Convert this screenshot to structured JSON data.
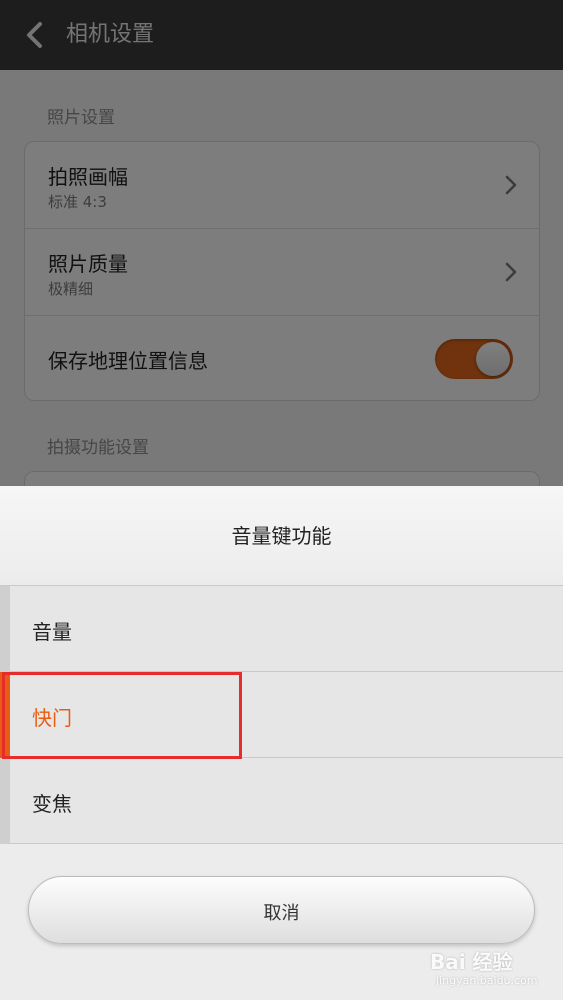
{
  "header": {
    "title": "相机设置"
  },
  "settings": {
    "photo_section": {
      "label": "照片设置",
      "items": [
        {
          "title": "拍照画幅",
          "subtitle": "标准 4:3"
        },
        {
          "title": "照片质量",
          "subtitle": "极精细"
        },
        {
          "title": "保存地理位置信息",
          "toggle_on": true
        }
      ]
    },
    "shooting_section": {
      "label": "拍摄功能设置"
    }
  },
  "dialog": {
    "title": "音量键功能",
    "options": [
      {
        "label": "音量",
        "selected": false
      },
      {
        "label": "快门",
        "selected": true
      },
      {
        "label": "变焦",
        "selected": false
      }
    ],
    "cancel_label": "取消"
  },
  "watermark": {
    "brand": "Bai 经验",
    "sub": "jingyan.baidu.com"
  },
  "colors": {
    "accent": "#e95d12",
    "toggle": "#e2661c",
    "highlight": "#e62c2c",
    "titlebar": "#3a3a3a"
  }
}
